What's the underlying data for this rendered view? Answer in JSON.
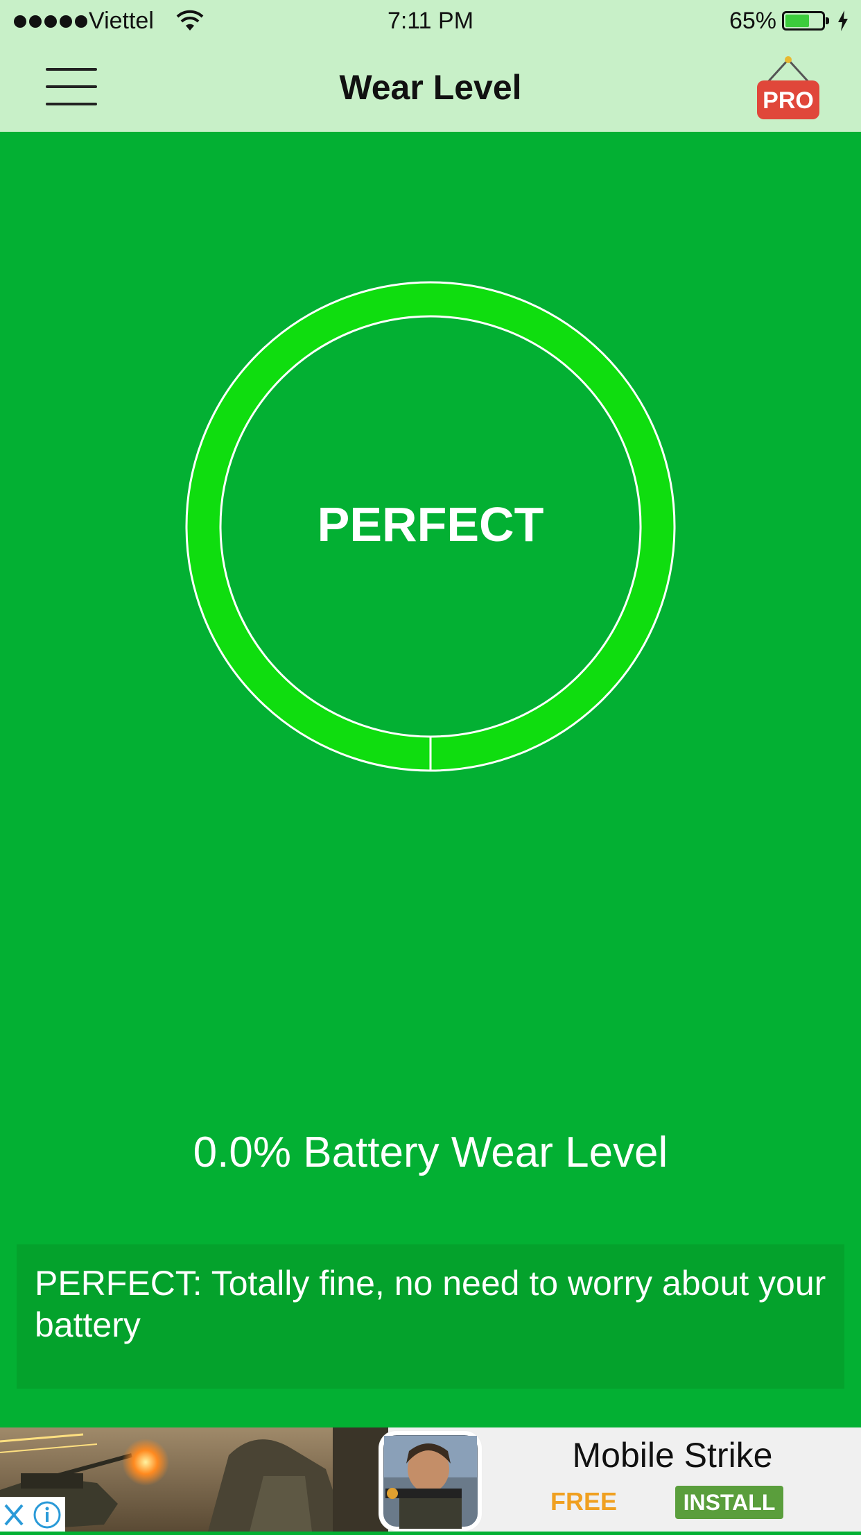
{
  "status_bar": {
    "carrier": "Viettel",
    "time": "7:11 PM",
    "battery_percent": "65%",
    "battery_level": 0.65,
    "charging": true
  },
  "nav": {
    "title": "Wear Level",
    "menu_icon": "hamburger-menu-icon",
    "pro_badge": "PRO"
  },
  "gauge": {
    "label": "PERFECT",
    "ring_color": "#0fdd0f",
    "inner_color": "#03b033"
  },
  "wear_level_text": "0.0% Battery Wear Level",
  "advice": "PERFECT: Totally fine, no need to worry about your battery",
  "ad": {
    "title": "Mobile Strike",
    "price": "FREE",
    "install_label": "INSTALL"
  },
  "colors": {
    "background": "#03b033",
    "header": "#c8f0c8",
    "pro_badge": "#e0473a",
    "install_button": "#5a9e3c",
    "price": "#f0a020"
  }
}
